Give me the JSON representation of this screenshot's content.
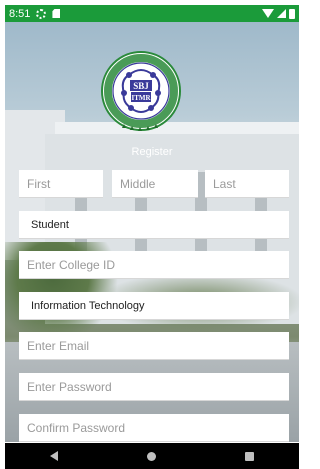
{
  "status_bar": {
    "time": "8:51",
    "icons": [
      "gear-icon",
      "sdcard-icon",
      "wifi-icon",
      "signal-icon",
      "battery-icon"
    ]
  },
  "logo": {
    "text": "SBTMR",
    "ring_text": "S.B. Jain Institute of Technology, Management & Research"
  },
  "page_title": "Register",
  "form": {
    "first_placeholder": "First",
    "middle_placeholder": "Middle",
    "last_placeholder": "Last",
    "role_value": "Student",
    "college_id_placeholder": "Enter College ID",
    "department_value": "Information Technology",
    "email_placeholder": "Enter Email",
    "password_placeholder": "Enter Password",
    "confirm_password_placeholder": "Confirm Password"
  },
  "nav_bar": {
    "icons": [
      "back-icon",
      "home-icon",
      "recents-icon"
    ]
  },
  "colors": {
    "status_bar": "#1b9b3a",
    "logo_green": "#2a8a3a",
    "logo_blue": "#3a3a9a"
  }
}
